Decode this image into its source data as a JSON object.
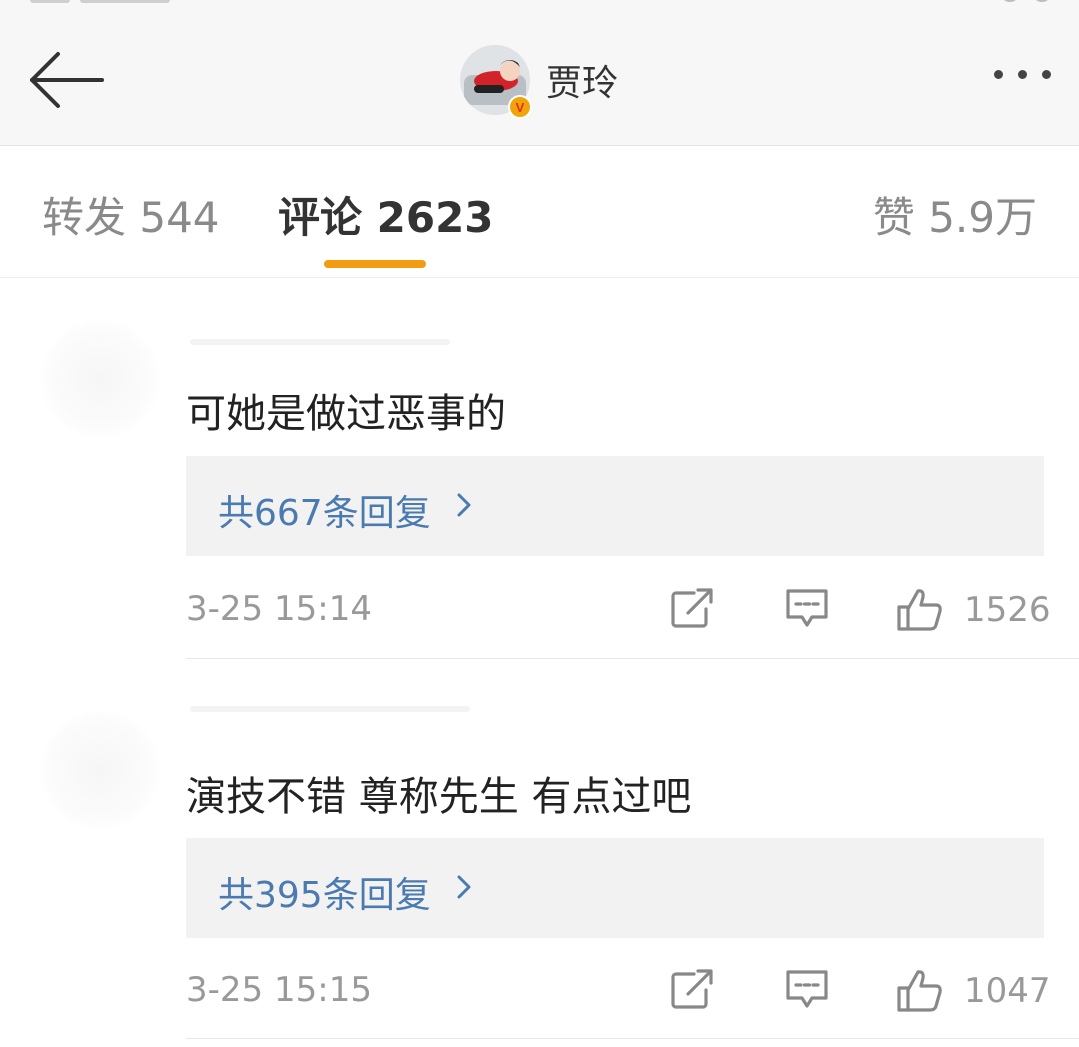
{
  "header": {
    "account_name": "贾玲",
    "verified_badge": "V",
    "icons": {
      "back": "arrow-left-icon",
      "more": "more-dots-icon",
      "badge": "verified-icon"
    }
  },
  "tabs": [
    {
      "label": "转发 544",
      "active": false
    },
    {
      "label": "评论 2623",
      "active": true
    },
    {
      "label": "赞 5.9万",
      "active": false
    }
  ],
  "accent_color": "#f39c12",
  "link_color": "#4a7bb0",
  "comments": [
    {
      "text": "可她是做过恶事的",
      "reply_summary": "共667条回复",
      "timestamp": "3-25 15:14",
      "likes": "1526"
    },
    {
      "text": "演技不错 尊称先生 有点过吧",
      "reply_summary": "共395条回复",
      "timestamp": "3-25 15:15",
      "likes": "1047"
    }
  ],
  "action_icons": [
    "share-icon",
    "comment-icon",
    "thumbs-up-icon"
  ]
}
